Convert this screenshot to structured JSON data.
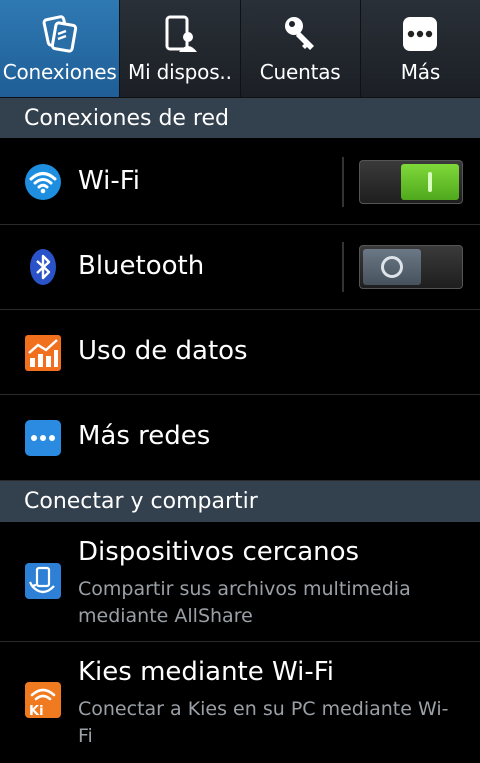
{
  "tabs": [
    {
      "label": "Conexiones",
      "icon": "connections-icon",
      "active": true
    },
    {
      "label": "Mi dispos..",
      "icon": "my-device-icon",
      "active": false
    },
    {
      "label": "Cuentas",
      "icon": "key-icon",
      "active": false
    },
    {
      "label": "Más",
      "icon": "more-icon",
      "active": false
    }
  ],
  "sections": {
    "network": "Conexiones de red",
    "share": "Conectar y compartir"
  },
  "network_items": {
    "wifi": {
      "label": "Wi-Fi",
      "on": true
    },
    "bluetooth": {
      "label": "Bluetooth",
      "on": false
    },
    "data_usage": {
      "label": "Uso de datos"
    },
    "more_networks": {
      "label": "Más redes"
    }
  },
  "share_items": {
    "nearby": {
      "title": "Dispositivos cercanos",
      "subtitle": "Compartir sus archivos multimedia mediante AllShare"
    },
    "kies": {
      "title": "Kies mediante Wi-Fi",
      "subtitle": "Conectar a Kies en su PC mediante Wi-Fi"
    }
  },
  "colors": {
    "active_tab": "#2f79b3",
    "section_bg": "#33404e",
    "toggle_on": "#6cc82e",
    "wifi_icon": "#1e8fe0",
    "bluetooth_icon": "#2a52c9",
    "data_usage_icon": "#f0701e",
    "kies_icon": "#f07a20"
  }
}
